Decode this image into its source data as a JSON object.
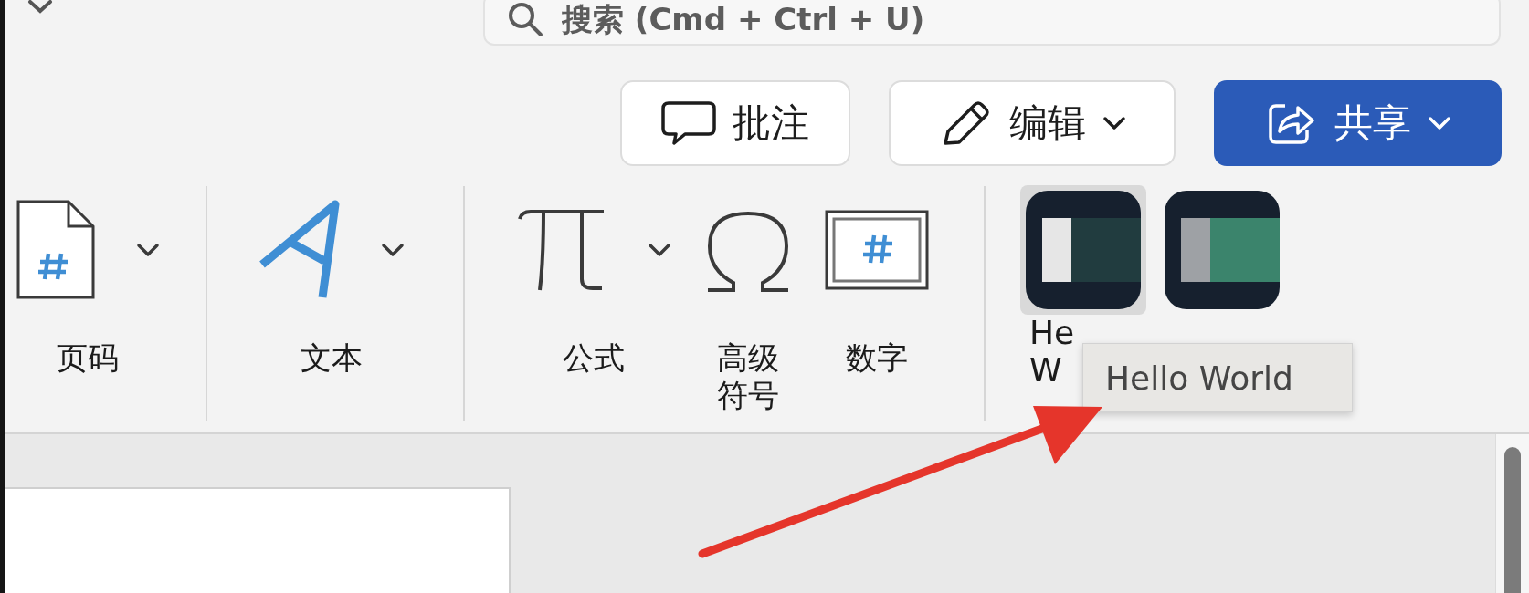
{
  "search": {
    "placeholder": "搜索 (Cmd + Ctrl + U)"
  },
  "buttons": [
    {
      "label": "批注",
      "kind": "comment",
      "dropdown": false
    },
    {
      "label": "编辑",
      "kind": "edit",
      "dropdown": true
    },
    {
      "label": "共享",
      "kind": "share",
      "dropdown": true
    }
  ],
  "ribbon": {
    "groups": [
      {
        "items": [
          {
            "label": "页码",
            "kind": "page-number",
            "dropdown": true
          }
        ]
      },
      {
        "items": [
          {
            "label": "文本",
            "kind": "text",
            "dropdown": true
          }
        ]
      },
      {
        "items": [
          {
            "label": "公式",
            "kind": "equation",
            "dropdown": true
          },
          {
            "label": "高级符号",
            "kind": "symbol",
            "dropdown": false
          },
          {
            "label": "数字",
            "kind": "number",
            "dropdown": false
          }
        ]
      },
      {
        "items": [
          {
            "label_lines": [
              "He",
              "W"
            ],
            "kind": "app",
            "selected": true
          },
          {
            "kind": "app",
            "selected": false
          }
        ]
      }
    ]
  },
  "tooltip": {
    "text": "Hello World"
  }
}
